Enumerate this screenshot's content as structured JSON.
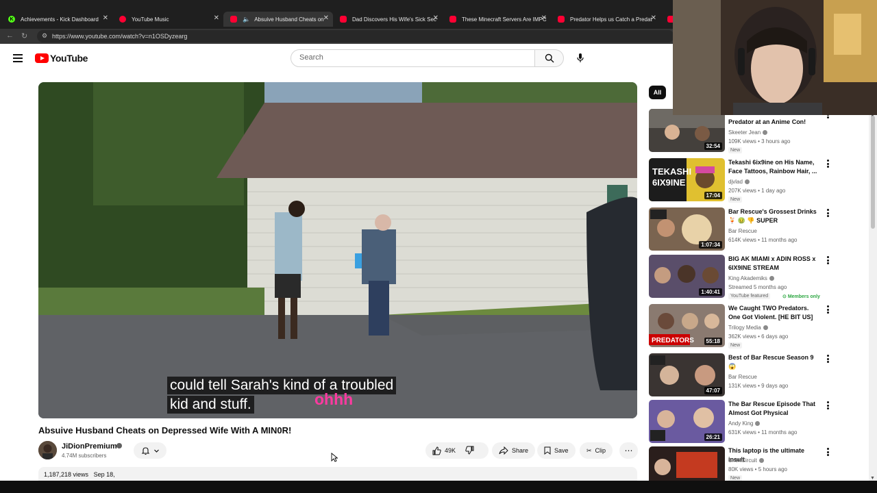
{
  "browser": {
    "tabs": [
      {
        "label": "Achievements - Kick Dashboard",
        "fav_color": "#53fc18",
        "fav_letter": "K"
      },
      {
        "label": "YouTube Music",
        "fav_color": "#ff0033",
        "fav_letter": ""
      },
      {
        "label": "Absuive Husband Cheats on",
        "fav_color": "#ff0033",
        "fav_letter": "",
        "active": true
      },
      {
        "label": "Dad Discovers His Wife's Sick Sec",
        "fav_color": "#ff0033",
        "fav_letter": ""
      },
      {
        "label": "These Minecraft Servers Are IMPC",
        "fav_color": "#ff0033",
        "fav_letter": ""
      },
      {
        "label": "Predator Helps us Catch a Predat",
        "fav_color": "#ff0033",
        "fav_letter": ""
      }
    ],
    "url": "https://www.youtube.com/watch?v=n1OSDyzearg"
  },
  "header": {
    "logo_text": "YouTube",
    "search_placeholder": "Search"
  },
  "player": {
    "caption_line1": "could tell Sarah's kind of a troubled",
    "caption_line2": "kid and stuff.",
    "overlay_text": "ohhh"
  },
  "video": {
    "title": "Absuive Husband Cheats on Depressed Wife With A MIN0R! ⁠⁠",
    "channel": "JiDionPremium",
    "subscribers": "4.74M subscribers",
    "likes": "49K",
    "share_label": "Share",
    "save_label": "Save",
    "clip_label": "Clip",
    "views": "1,187,218 views",
    "date": "Sep 18,"
  },
  "sidebar": {
    "chip_all": "All",
    "items": [
      {
        "title": "Predator at an Anime Con!",
        "channel": "Skeeter Jean",
        "meta": "109K views • 3 hours ago",
        "badge": "New",
        "duration": "32:54",
        "verified": true
      },
      {
        "title": "Tekashi 6ix9ine on His Name, Face Tattoos, Rainbow Hair, ...",
        "channel": "djvlad",
        "meta": "207K views • 1 day ago",
        "badge": "New",
        "duration": "17:04",
        "verified": true
      },
      {
        "title": "Bar Rescue's Grossest Drinks 🍹 🤢 👎 SUPER COMPILATION",
        "channel": "Bar Rescue",
        "meta": "614K views • 11 months ago",
        "badge": "",
        "duration": "1:07:34",
        "verified": false
      },
      {
        "title": "BIG AK MIAMI x ADIN ROSS x 6IX9INE STREAM",
        "channel": "King Akademiks",
        "meta": "Streamed 5 months ago",
        "badge": "YouTube featured",
        "members": "Members only",
        "duration": "1:40:41",
        "verified": true
      },
      {
        "title": "We Caught TWO Predators. One Got Violent. [HE BIT US] feat. ...",
        "channel": "Trilogy Media",
        "meta": "362K views • 6 days ago",
        "badge": "New",
        "duration": "55:18",
        "verified": true
      },
      {
        "title": "Best of Bar Rescue Season 9 😱",
        "channel": "Bar Rescue",
        "meta": "131K views • 9 days ago",
        "badge": "",
        "duration": "47:07",
        "verified": false
      },
      {
        "title": "The Bar Rescue Episode That Almost Got Physical",
        "channel": "Andy King",
        "meta": "631K views • 11 months ago",
        "badge": "",
        "duration": "26:21",
        "verified": true
      },
      {
        "title": "This laptop is the ultimate insult",
        "channel": "ShortCircuit",
        "meta": "80K views • 5 hours ago",
        "badge": "New",
        "duration": "",
        "verified": true
      }
    ]
  },
  "colors": {
    "accent_red": "#ff0000",
    "caption_overlay": "#ff3aa1",
    "members_green": "#2ba640"
  }
}
